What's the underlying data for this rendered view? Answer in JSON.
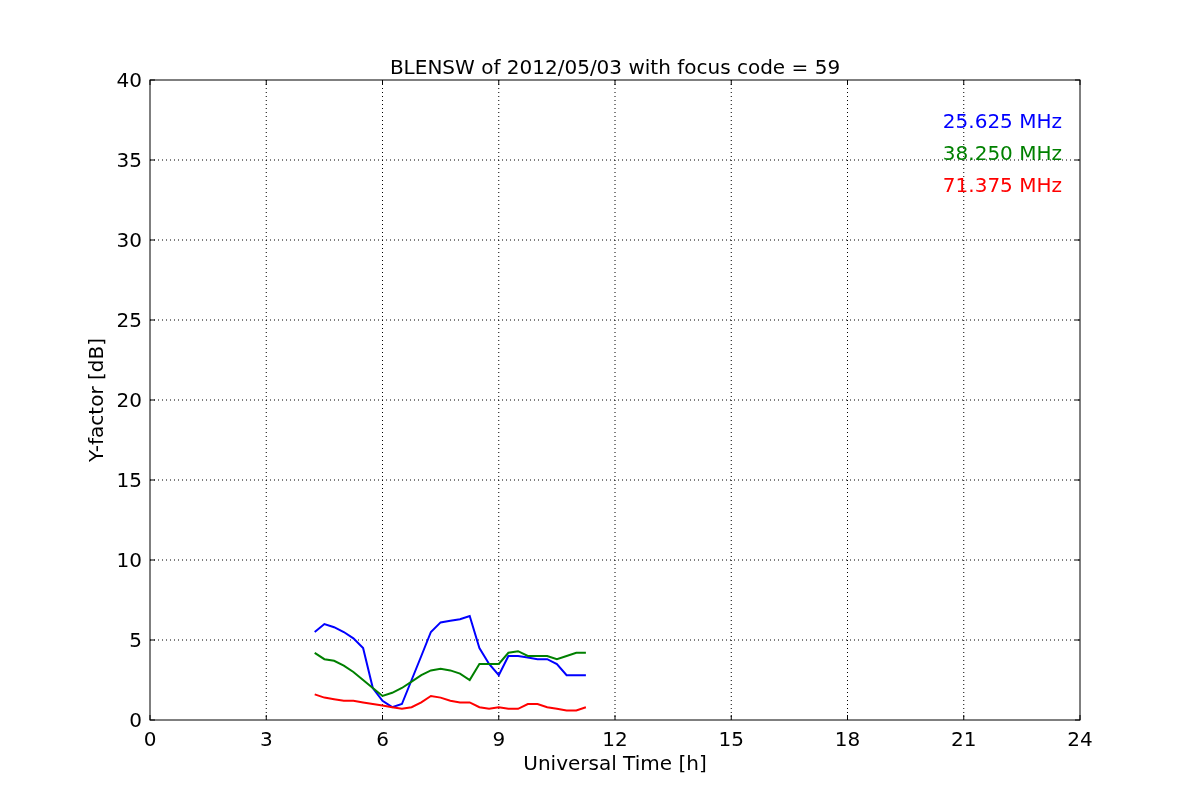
{
  "chart_data": {
    "type": "line",
    "title": "BLENSW of 2012/05/03 with focus code = 59",
    "xlabel": "Universal Time [h]",
    "ylabel": "Y-factor [dB]",
    "x": [
      4.25,
      4.5,
      4.75,
      5,
      5.25,
      5.5,
      5.75,
      6,
      6.25,
      6.5,
      6.75,
      7,
      7.25,
      7.5,
      7.75,
      8,
      8.25,
      8.5,
      8.75,
      9,
      9.25,
      9.5,
      9.75,
      10,
      10.25,
      10.5,
      10.75,
      11,
      11.25
    ],
    "series": [
      {
        "name": "25.625 MHz",
        "color": "#0000ff",
        "values": [
          5.5,
          6.0,
          5.8,
          5.5,
          5.1,
          4.5,
          2.0,
          1.2,
          0.8,
          1.0,
          2.5,
          4.0,
          5.5,
          6.1,
          6.2,
          6.3,
          6.5,
          4.5,
          3.5,
          2.8,
          4.0,
          4.0,
          3.9,
          3.8,
          3.8,
          3.5,
          2.8,
          2.8,
          2.8
        ]
      },
      {
        "name": "38.250 MHz",
        "color": "#008000",
        "values": [
          4.2,
          3.8,
          3.7,
          3.4,
          3.0,
          2.5,
          2.0,
          1.5,
          1.7,
          2.0,
          2.4,
          2.8,
          3.1,
          3.2,
          3.1,
          2.9,
          2.5,
          3.5,
          3.5,
          3.5,
          4.2,
          4.3,
          4.0,
          4.0,
          4.0,
          3.8,
          4.0,
          4.2,
          4.2
        ]
      },
      {
        "name": "71.375 MHz",
        "color": "#ff0000",
        "values": [
          1.6,
          1.4,
          1.3,
          1.2,
          1.2,
          1.1,
          1.0,
          0.9,
          0.8,
          0.7,
          0.8,
          1.1,
          1.5,
          1.4,
          1.2,
          1.1,
          1.1,
          0.8,
          0.7,
          0.8,
          0.7,
          0.7,
          1.0,
          1.0,
          0.8,
          0.7,
          0.6,
          0.6,
          0.8
        ]
      }
    ],
    "grid": true,
    "xlim": [
      0,
      24
    ],
    "ylim": [
      0,
      40
    ],
    "xticks": [
      0,
      3,
      6,
      9,
      12,
      15,
      18,
      21,
      24
    ],
    "yticks": [
      0,
      5,
      10,
      15,
      20,
      25,
      30,
      35,
      40
    ]
  }
}
